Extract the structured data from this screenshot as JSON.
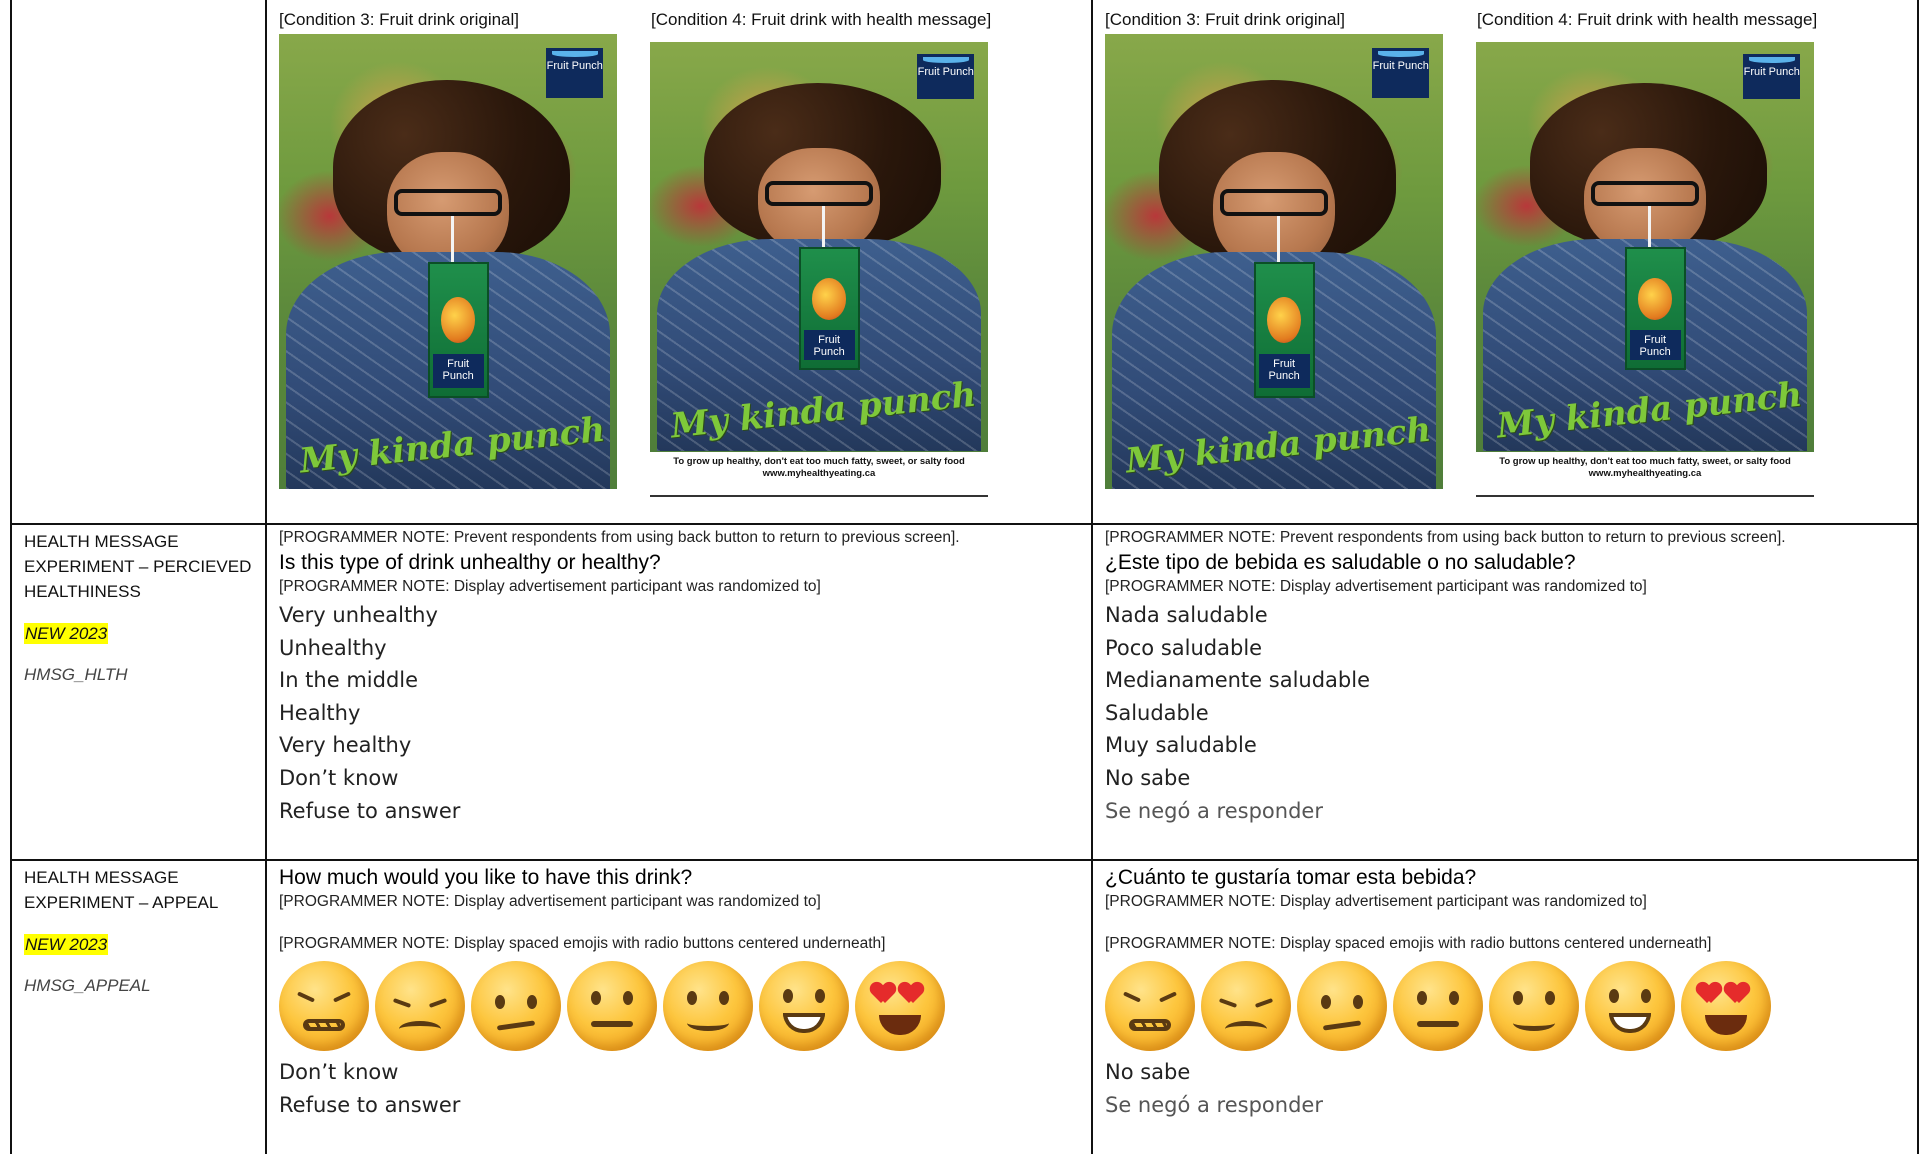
{
  "images_row": {
    "english": {
      "condition_3_label": "[Condition 3: Fruit drink original]",
      "condition_4_label": "[Condition 4: Fruit drink with health message]"
    },
    "spanish": {
      "condition_3_label": "[Condition 3: Fruit drink original]",
      "condition_4_label": "[Condition 4: Fruit drink with health message]"
    },
    "ad": {
      "brand": "Fruit Punch",
      "slogan": "My kinda punch",
      "health_message": "To grow up healthy, don't eat too much fatty, sweet, or salty food",
      "website": "www.myhealthyeating.ca"
    }
  },
  "health_row": {
    "label": {
      "title": "HEALTH MESSAGE EXPERIMENT – PERCIEVED HEALTHINESS",
      "badge": "NEW 2023",
      "code": "HMSG_HLTH"
    },
    "english": {
      "note_back": "[PROGRAMMER NOTE: Prevent respondents from using back button to return to previous screen].",
      "question": "Is this type of drink unhealthy or healthy?",
      "note_display": "[PROGRAMMER NOTE: Display advertisement participant was randomized to]",
      "options": [
        "Very unhealthy",
        "Unhealthy",
        "In the middle",
        "Healthy",
        "Very healthy",
        "Don’t know",
        "Refuse to answer"
      ]
    },
    "spanish": {
      "note_back": "[PROGRAMMER NOTE: Prevent respondents from using back button to return to previous screen].",
      "question": "¿Este tipo de bebida es saludable o no saludable?",
      "note_display": "[PROGRAMMER NOTE: Display advertisement participant was randomized to]",
      "options": [
        "Nada saludable",
        "Poco saludable",
        "Medianamente saludable",
        "Saludable",
        "Muy saludable",
        "No sabe",
        "Se negó a responder"
      ]
    }
  },
  "appeal_row": {
    "label": {
      "title": "HEALTH MESSAGE EXPERIMENT – APPEAL",
      "badge": "NEW 2023",
      "code": "HMSG_APPEAL"
    },
    "english": {
      "question": "How much would you like to have this drink?",
      "note_display": "[PROGRAMMER NOTE: Display advertisement participant was randomized to]",
      "note_emoji": "[PROGRAMMER NOTE: Display spaced emojis with radio buttons centered underneath]",
      "options": [
        "Don’t know",
        "Refuse to answer"
      ]
    },
    "spanish": {
      "question": "¿Cuánto te gustaría tomar esta bebida?",
      "note_display": "[PROGRAMMER NOTE: Display advertisement participant was randomized to]",
      "note_emoji": "[PROGRAMMER NOTE: Display spaced emojis with radio buttons centered underneath]",
      "options": [
        "No sabe",
        "Se negó a responder"
      ]
    },
    "emoji_scale": [
      "confounded-face-icon",
      "disappointed-face-icon",
      "confused-face-icon",
      "neutral-face-icon",
      "slightly-smiling-face-icon",
      "grinning-face-icon",
      "heart-eyes-face-icon"
    ]
  }
}
